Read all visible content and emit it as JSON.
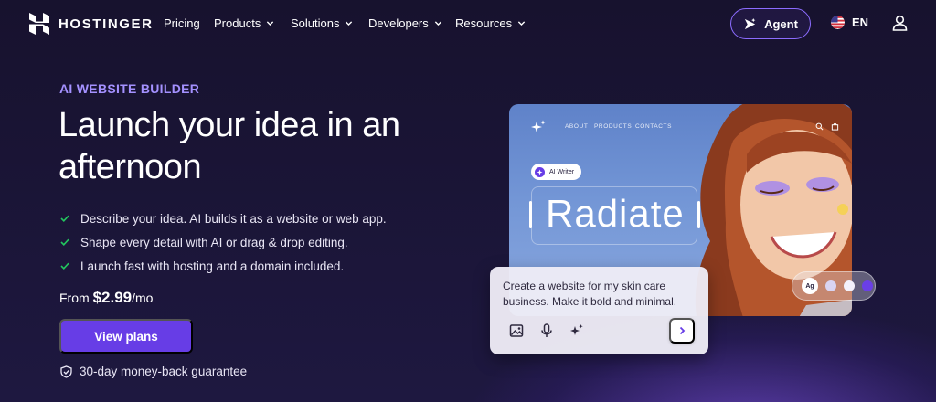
{
  "nav": {
    "brand": "HOSTINGER",
    "links": [
      {
        "label": "Pricing",
        "has_dropdown": false
      },
      {
        "label": "Products",
        "has_dropdown": true
      },
      {
        "label": "Solutions",
        "has_dropdown": true
      },
      {
        "label": "Developers",
        "has_dropdown": true
      },
      {
        "label": "Resources",
        "has_dropdown": true
      }
    ],
    "agent_label": "Agent",
    "language": "EN"
  },
  "hero": {
    "eyebrow": "AI WEBSITE BUILDER",
    "headline": "Launch your idea in an afternoon",
    "features": [
      "Describe your idea. AI builds it as a website or web app.",
      "Shape every detail with AI or drag & drop editing.",
      "Launch fast with hosting and a domain included."
    ],
    "price_prefix": "From ",
    "price_amount": "$2.99",
    "price_suffix": "/mo",
    "cta_label": "View plans",
    "guarantee": "30-day money-back guarantee"
  },
  "preview": {
    "nav_items": [
      "ABOUT",
      "PRODUCTS",
      "CONTACTS"
    ],
    "ai_chip_label": "AI Writer",
    "headline_word": "Radiate",
    "prompt_text": "Create a website for my skin care business. Make it bold and minimal.",
    "font_badge": "Ag",
    "swatches": [
      "#d9d4f2",
      "#f3f1fb",
      "#6a3fe6"
    ]
  },
  "colors": {
    "background": "#1d1739",
    "accent": "#673de6",
    "eyebrow": "#a491ff",
    "check": "#22c55e"
  }
}
